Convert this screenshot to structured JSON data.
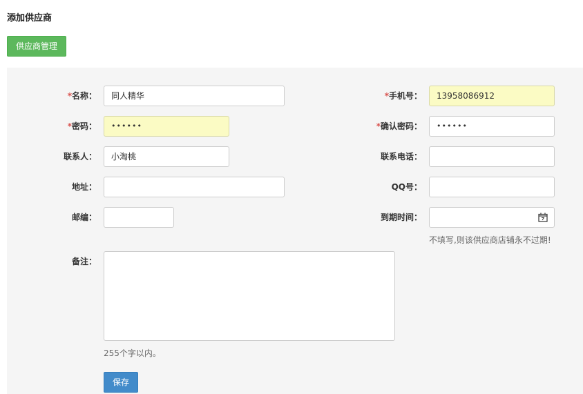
{
  "page": {
    "title": "添加供应商"
  },
  "actions": {
    "manage_label": "供应商管理",
    "save_label": "保存"
  },
  "form": {
    "required_mark": "*",
    "name": {
      "label": "名称：",
      "value": "同人精华"
    },
    "phone": {
      "label": "手机号：",
      "value": "13958086912"
    },
    "password": {
      "label": "密码：",
      "value": "••••••"
    },
    "confirm_password": {
      "label": "确认密码：",
      "value": "••••••"
    },
    "contact": {
      "label": "联系人：",
      "value": "小淘桃"
    },
    "contact_phone": {
      "label": "联系电话：",
      "value": ""
    },
    "address": {
      "label": "地址：",
      "value": ""
    },
    "qq": {
      "label": "QQ号：",
      "value": ""
    },
    "zipcode": {
      "label": "邮编：",
      "value": ""
    },
    "expire": {
      "label": "到期时间：",
      "value": "",
      "hint": "不填写,则该供应商店铺永不过期!"
    },
    "note": {
      "label": "备注：",
      "value": "",
      "hint": "255个字以内。"
    }
  },
  "colors": {
    "manage_button": "#5cb85c",
    "save_button": "#428bca",
    "autofill_field": "#fbfbc4",
    "required": "#d9534f",
    "panel": "#f5f5f5"
  },
  "icons": {
    "expire_picker": "calendar-icon"
  }
}
